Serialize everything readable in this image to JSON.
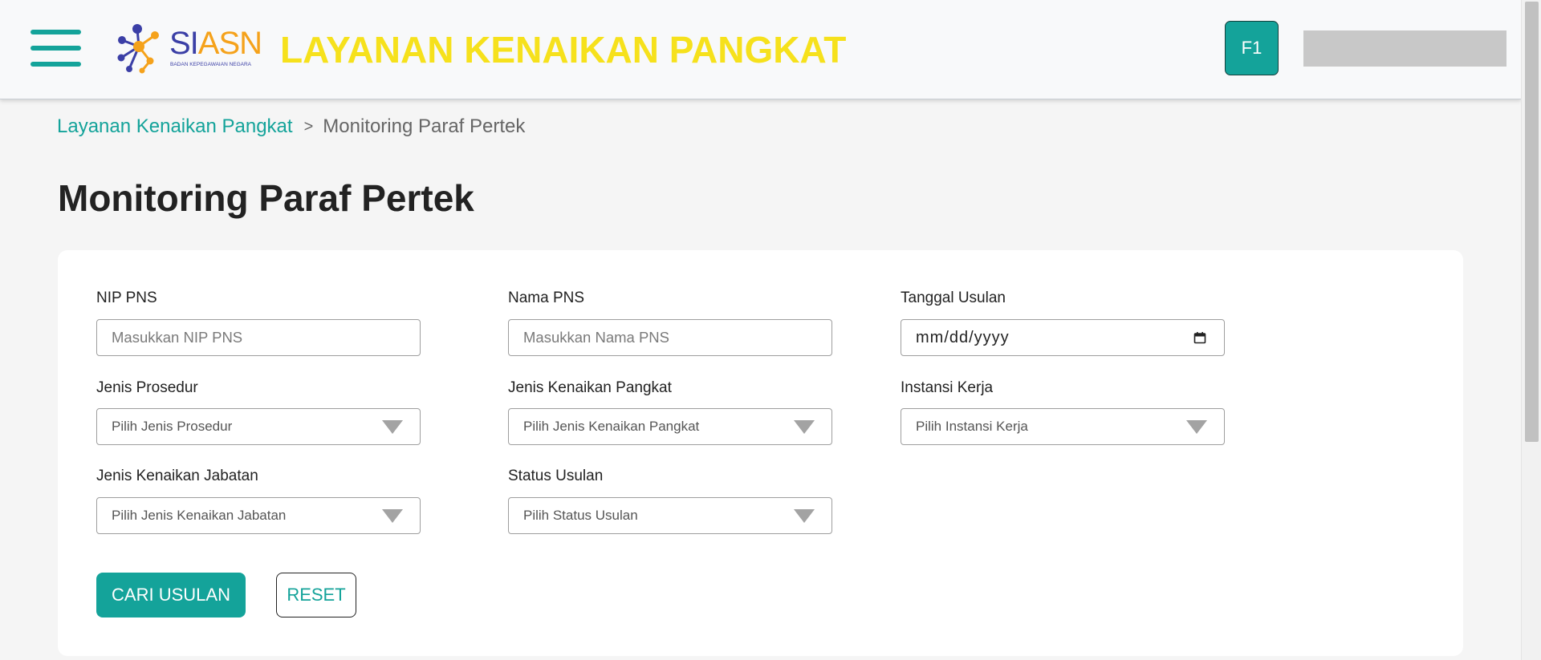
{
  "header": {
    "menu_icon": "hamburger-menu-icon",
    "logo": {
      "icon": "siasn-logo-icon",
      "wordmark_primary": "SI",
      "wordmark_accent": "ASN",
      "subtitle": "BADAN KEPEGAWAIAN NEGARA"
    },
    "title": "LAYANAN KENAIKAN PANGKAT",
    "user_avatar": "F1"
  },
  "breadcrumb": {
    "items": [
      {
        "label": "Layanan Kenaikan Pangkat"
      },
      {
        "label": "Monitoring Paraf Pertek"
      }
    ],
    "separator": ">"
  },
  "page_title": "Monitoring Paraf Pertek",
  "form": {
    "nip": {
      "label": "NIP PNS",
      "placeholder": "Masukkan NIP PNS"
    },
    "nama": {
      "label": "Nama PNS",
      "placeholder": "Masukkan Nama PNS"
    },
    "tanggal": {
      "label": "Tanggal Usulan",
      "placeholder": "mm/dd/yyyy",
      "icon": "calendar-icon"
    },
    "jenis_prosedur": {
      "label": "Jenis Prosedur",
      "placeholder": "Pilih Jenis Prosedur"
    },
    "jenis_kenaikan_pangkat": {
      "label": "Jenis Kenaikan Pangkat",
      "placeholder": "Pilih Jenis Kenaikan Pangkat"
    },
    "instansi_kerja": {
      "label": "Instansi Kerja",
      "placeholder": "Pilih Instansi Kerja"
    },
    "jenis_kenaikan_jabatan": {
      "label": "Jenis Kenaikan Jabatan",
      "placeholder": "Pilih Jenis Kenaikan Jabatan"
    },
    "status_usulan": {
      "label": "Status Usulan",
      "placeholder": "Pilih Status Usulan"
    },
    "dropdown_icon": "triangle-down-icon"
  },
  "actions": {
    "search_label": "CARI USULAN",
    "reset_label": "RESET"
  },
  "colors": {
    "accent": "#14a39a",
    "title_yellow": "#f6e11c",
    "logo_blue": "#3b3fa6",
    "logo_orange": "#f5a21b",
    "redacted_block": "#c8c8c8"
  }
}
